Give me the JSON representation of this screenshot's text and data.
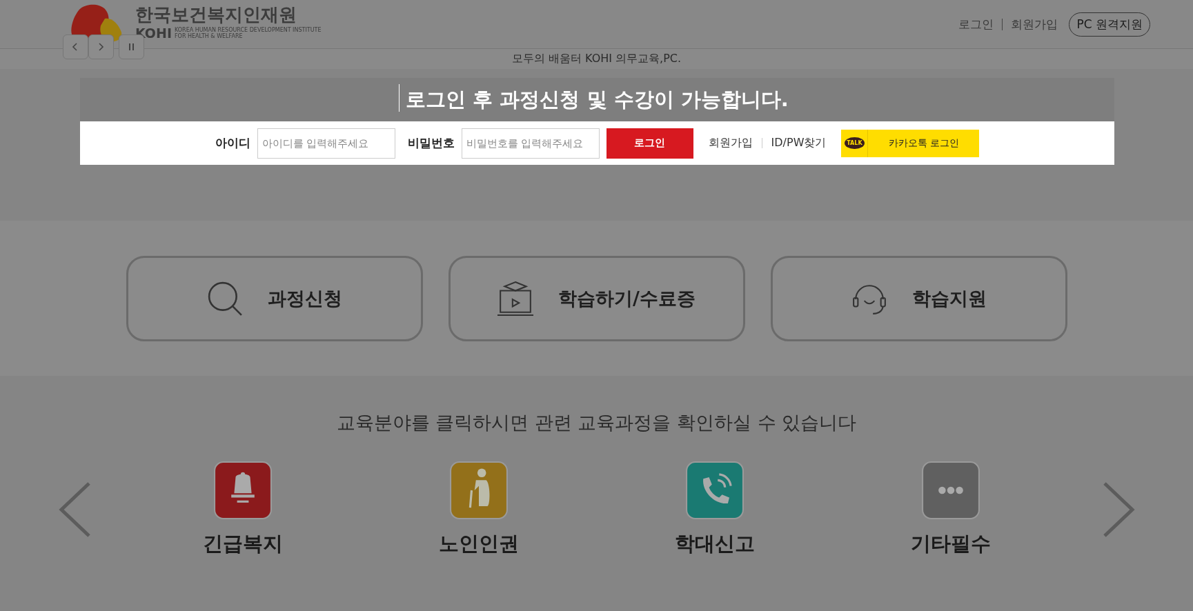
{
  "header": {
    "logo": {
      "name": "한국보건복지인재원",
      "abbr": "KOHI",
      "subtitle_lines": [
        "KOREA HUMAN RESOURCE DEVELOPMENT INSTITUTE",
        "FOR HEALTH & WELFARE"
      ]
    },
    "slide_controls": [
      {
        "kind": "prev"
      },
      {
        "kind": "next"
      },
      {
        "kind": "pause"
      }
    ],
    "links": [
      "로그인",
      "회원가입"
    ],
    "remote_support": "PC 원격지원"
  },
  "notice": "모두의 배움터 KOHI 의무교육,PC.",
  "login_modal": {
    "title": "로그인 후 과정신청 및 수강이 가능합니다.",
    "fields": [
      {
        "label": "아이디",
        "placeholder": "아이디를 입력해주세요"
      },
      {
        "label": "비밀번호",
        "placeholder": "비밀번호를 입력해주세요"
      }
    ],
    "login_button": "로그인",
    "links": [
      "회원가입",
      "ID/PW찾기"
    ],
    "kakao_badge": "TALK",
    "kakao_button": "카카오톡 로그인"
  },
  "quick_menu": [
    {
      "kind": "search",
      "label": "과정신청"
    },
    {
      "kind": "lecture",
      "label": "학습하기/수료증"
    },
    {
      "kind": "headset",
      "label": "학습지원"
    }
  ],
  "category_section": {
    "intro": "교육분야를 클릭하시면 관련 교육과정을 확인하실 수 있습니다",
    "categories": [
      {
        "kind": "bell",
        "label": "긴급복지",
        "color": "#8b1a1c"
      },
      {
        "kind": "elder",
        "label": "노인인권",
        "color": "#93701a"
      },
      {
        "kind": "phone",
        "label": "학대신고",
        "color": "#1a7a72"
      },
      {
        "kind": "dots",
        "label": "기타필수",
        "color": "#606060"
      }
    ]
  }
}
